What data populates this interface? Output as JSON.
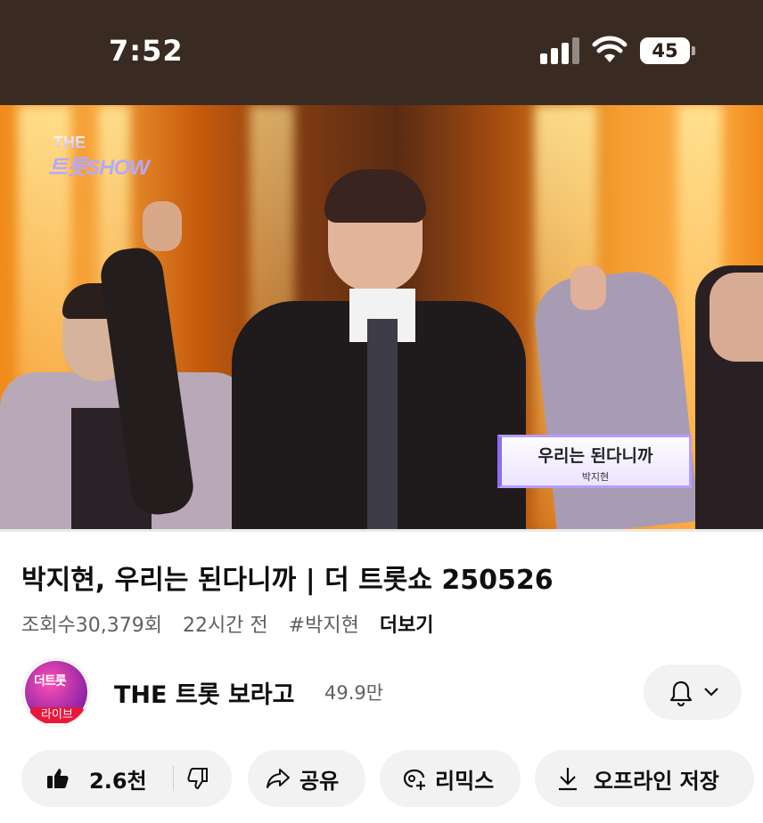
{
  "status_bar": {
    "time": "7:52",
    "battery": "45"
  },
  "video": {
    "show_logo_line1": "THE",
    "show_logo_line2": "트롯SHOW",
    "caption_title": "우리는 된다니까",
    "caption_artist": "박지현",
    "progress": 0
  },
  "info": {
    "title": "박지현, 우리는 된다니까 | 더 트롯쇼 250526",
    "views": "조회수30,379회",
    "age": "22시간 전",
    "hashtag": "#박지현",
    "more": "더보기"
  },
  "channel": {
    "avatar_text": "더트롯",
    "avatar_badge": "라이브",
    "name": "THE 트롯 보라고",
    "subscribers": "49.9만"
  },
  "actions": {
    "like_count": "2.6천",
    "share": "공유",
    "remix": "리믹스",
    "download": "오프라인 저장"
  },
  "colors": {
    "status_bar_bg": "#3a2b22",
    "chip_bg": "#f2f2f2",
    "progress": "#ff0000"
  },
  "icons": [
    "cellular-signal-icon",
    "wifi-icon",
    "battery-icon",
    "bell-icon",
    "chevron-down-icon",
    "thumbs-up-icon",
    "thumbs-down-icon",
    "share-icon",
    "remix-icon",
    "download-icon"
  ]
}
